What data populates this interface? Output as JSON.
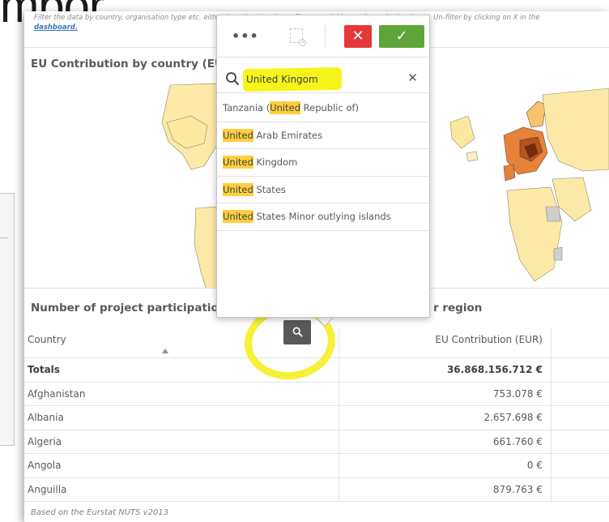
{
  "background": {
    "title_fragment": "mbor"
  },
  "intro": {
    "text": "Filter the data by country, organisation type etc. either by using the above filters or clicking on items in the charts. Un-filter by clicking on X in the",
    "link": "dashboard."
  },
  "map": {
    "title": "EU Contribution by country (EU"
  },
  "table": {
    "title_left": "Number of project participatio",
    "title_right": "r region",
    "header": {
      "country": "Country",
      "value": "EU Contribution (EUR)"
    },
    "totals": {
      "label": "Totals",
      "value": "36.868.156.712 €"
    },
    "rows": [
      {
        "country": "Afghanistan",
        "value": "753.078 €"
      },
      {
        "country": "Albania",
        "value": "2.657.698 €"
      },
      {
        "country": "Algeria",
        "value": "661.760 €"
      },
      {
        "country": "Angola",
        "value": "0 €"
      },
      {
        "country": "Anguilla",
        "value": "879.763 €"
      }
    ],
    "footer": "Based on the Eurstat NUTS v2013"
  },
  "popover": {
    "toolbar": {
      "more": "•••",
      "cancel": "✕",
      "confirm": "✓"
    },
    "search": {
      "value": "United Kingom",
      "clear": "✕"
    },
    "results": [
      {
        "match": "United",
        "pre": "Tanzania (",
        "post": " Republic of)"
      },
      {
        "match": "United",
        "pre": "",
        "post": " Arab Emirates"
      },
      {
        "match": "United",
        "pre": "",
        "post": " Kingdom"
      },
      {
        "match": "United",
        "pre": "",
        "post": " States"
      },
      {
        "match": "United",
        "pre": "",
        "post": " States Minor outlying islands"
      }
    ]
  },
  "colors": {
    "cancel": "#e5383b",
    "confirm": "#5ea438",
    "match_highlight": "#ffcf3f",
    "annotation_highlight": "#f6ee1f",
    "map_land": "#fce9a8",
    "map_dark": "#7a2a0c"
  }
}
